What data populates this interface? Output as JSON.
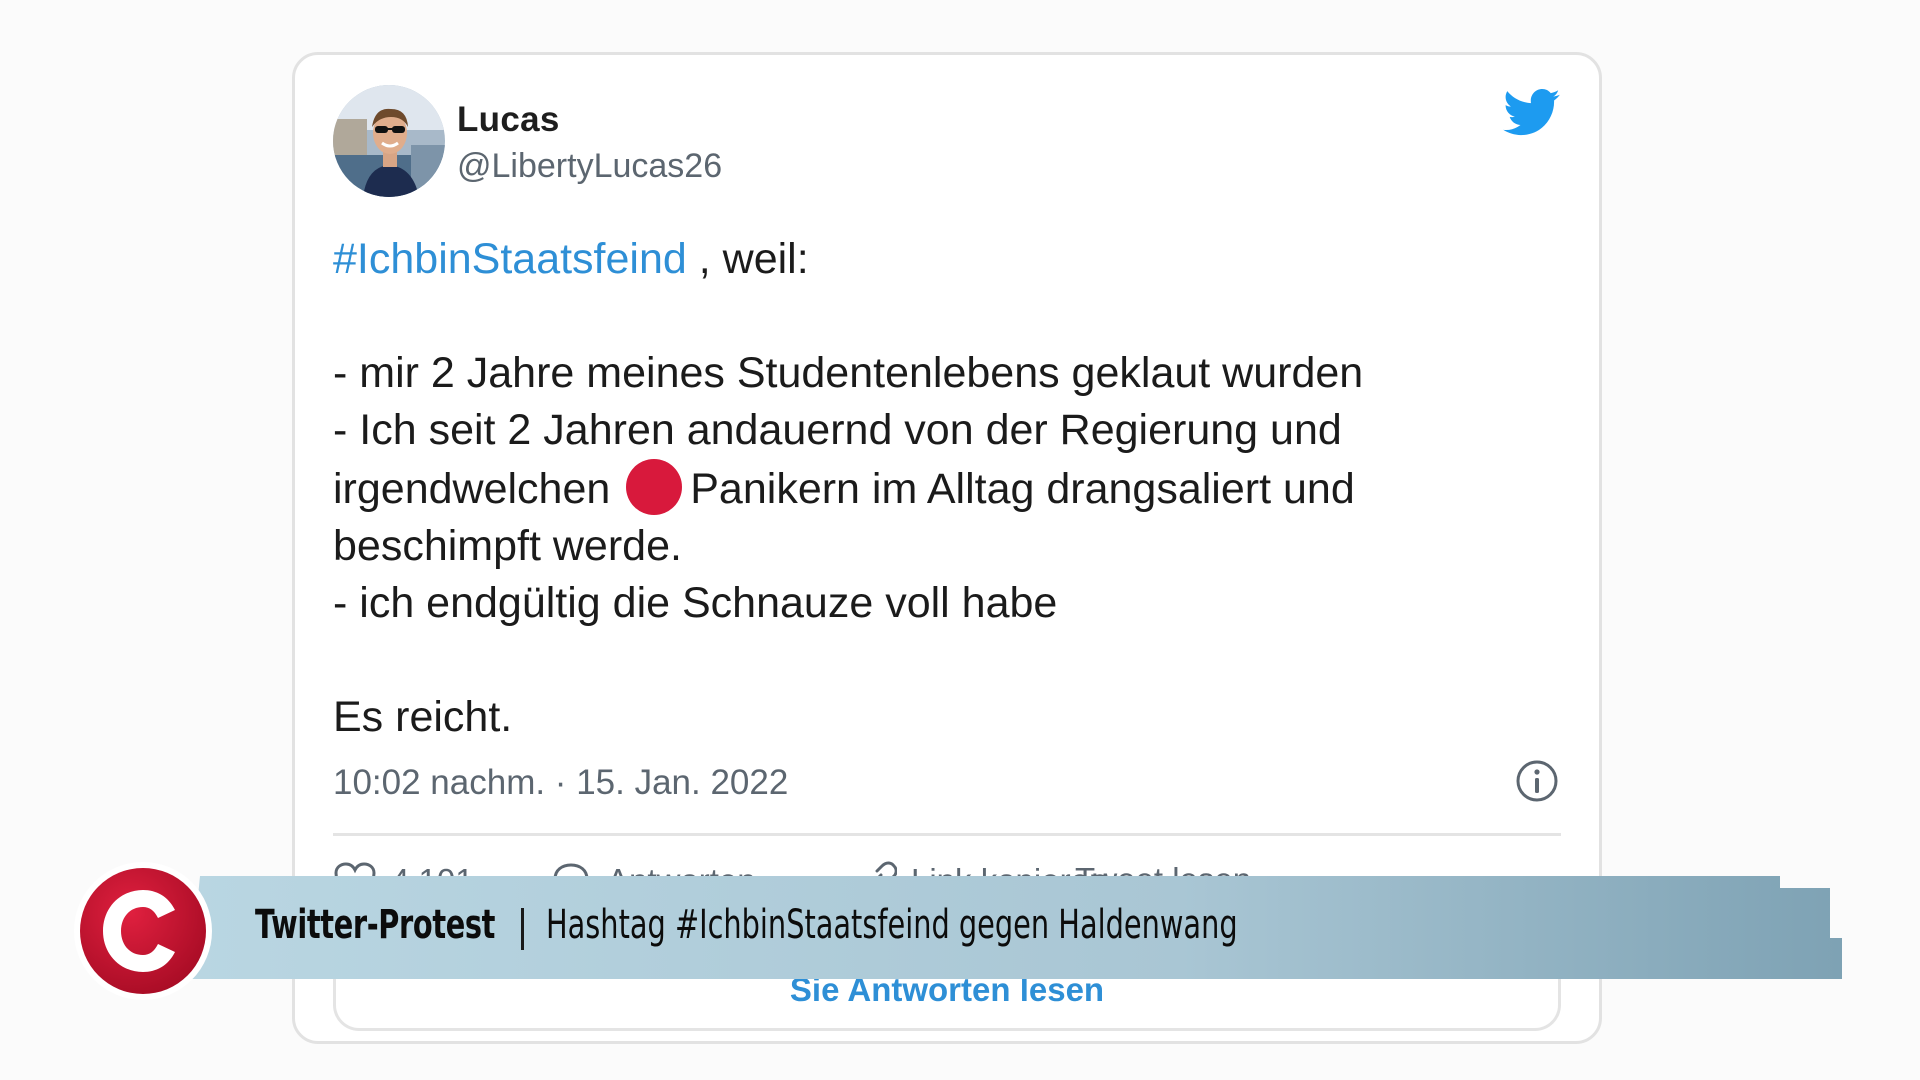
{
  "tweet": {
    "display_name": "Lucas",
    "handle": "@LibertyLucas26",
    "hashtag": "#IchbinStaatsfeind",
    "intro_rest": " , weil:",
    "line1": "- mir 2 Jahre meines Studentenlebens geklaut wurden",
    "line2": "- Ich seit 2 Jahren andauernd von der Regierung und",
    "line3_start": "irgendwelchen",
    "line3_end": "Panikern im Alltag drangsaliert und",
    "line4": "beschimpft werde.",
    "line5": "- ich endgültig die Schnauze voll habe",
    "closing": "Es reicht.",
    "timestamp": "10:02 nachm. · 15. Jan. 2022",
    "actions": {
      "likes": "4.101",
      "reply": "Antworten",
      "share": "Link kopieren",
      "read": "Tweet lesen"
    },
    "replies_link": "Sie Antworten lesen",
    "red_dot_color": "#d8193c",
    "link_color": "#2e8fd6"
  },
  "banner": {
    "title": "Twitter-Protest",
    "subtitle": "Hashtag #IchbinStaatsfeind gegen Haldenwang",
    "logo_letter": "C",
    "logo_color": "#c8102e"
  }
}
